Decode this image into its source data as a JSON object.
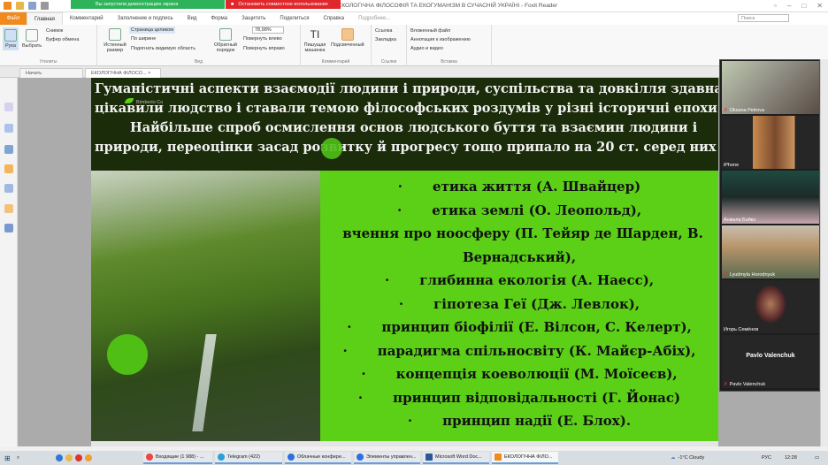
{
  "window": {
    "title": "ЕКОЛОГІЧНА ФІЛОСОФІЯ ТА ЕКОГУМАНІЗМ В СУЧАСНІЙ УКРАЇНІ - Foxit Reader"
  },
  "share_banner": {
    "status": "Вы запустили демонстрацию экрана",
    "stop": "Остановить совместное использование"
  },
  "menu": {
    "tabs": [
      "Файл",
      "Главная",
      "Комментарий",
      "Заполнение и подпись",
      "Вид",
      "Форма",
      "Защитить",
      "Поделиться",
      "Справка",
      "Подробнее..."
    ],
    "search_placeholder": "Поиск"
  },
  "ribbon": {
    "tools": {
      "hand": "Рука",
      "select": "Выбрать",
      "snapshot": "Снимок",
      "clipboard": "Буфер обмена",
      "label": "Утилиты"
    },
    "view": {
      "actual": "Истинный размер",
      "fit_page": "Страница целиком",
      "fit_width": "По ширине",
      "fit_visible": "Подогнать видимую область",
      "reverse": "Обратный порядок",
      "zoom": "78,98%",
      "rotate_left": "Повернуть влево",
      "rotate_right": "Повернуть вправо",
      "label": "Вид"
    },
    "comment": {
      "typewriter": "Пишущая машинка",
      "highlight": "Подсвеченный",
      "label": "Комментарий"
    },
    "links": {
      "link": "Ссылка",
      "bookmark": "Закладка",
      "label": "Ссылки"
    },
    "insert": {
      "file": "Вложенный файл",
      "image": "Аннотация к изображению",
      "av": "Аудио и видео",
      "label": "Вставка"
    }
  },
  "doc_tabs": [
    "Начать",
    "ЕКОЛОГІЧНА ФІЛОСО..."
  ],
  "slide": {
    "header": [
      "Гуманістичні аспекти взаємодії людини і природи, суспільства та довкілля здавна",
      "цікавили людство і ставали темою філософських роздумів у різні історичні епохи.",
      "Найбільше спроб осмислення основ людського буття та взаємин людини і",
      "природи, переоцінки засад розвитку й прогресу тощо припало на 20 ст. серед них"
    ],
    "logo": "Bimberio Co",
    "bullet": "·",
    "items": [
      "етика життя (А. Швайцер)",
      "етика землі (О. Леопольд),",
      "вчення про ноосферу (П. Тейяр де Шарден, В.",
      "Вернадський),",
      "глибинна екологія (А. Наесс),",
      "гіпотеза Геї (Дж. Левлок),",
      "принцип біофілії (Е. Вілсон, С. Келерт),",
      "парадигма спільносвіту (К. Майєр-Абіх),",
      "концепція коеволюції (М. Моїсеєв),",
      "принцип відповідальності (Г. Йонас)",
      "принцип надії (Е. Блох)."
    ]
  },
  "participants": [
    {
      "name": "Oksana Petrova",
      "muted": true
    },
    {
      "name": "iPhone",
      "muted": false
    },
    {
      "name": "Анжела Бойко",
      "muted": false
    },
    {
      "name": "Lyudmyla Horodnyuk",
      "muted": true
    },
    {
      "name": "Игорь Семёнов",
      "muted": false
    },
    {
      "name": "Pavlo Valenchuk",
      "muted": true,
      "big_name": "Pavlo Valenchuk"
    }
  ],
  "taskbar": {
    "apps": [
      "Входящие (1 988) - ...",
      "Telegram (422)",
      "Облачные конфере...",
      "Элементы управлен...",
      "Microsoft Word Doc...",
      "ЕКОЛОГІЧНА ФІЛО..."
    ],
    "weather": "-1°C  Cloudy",
    "lang": "РУС",
    "time": "12:28"
  }
}
